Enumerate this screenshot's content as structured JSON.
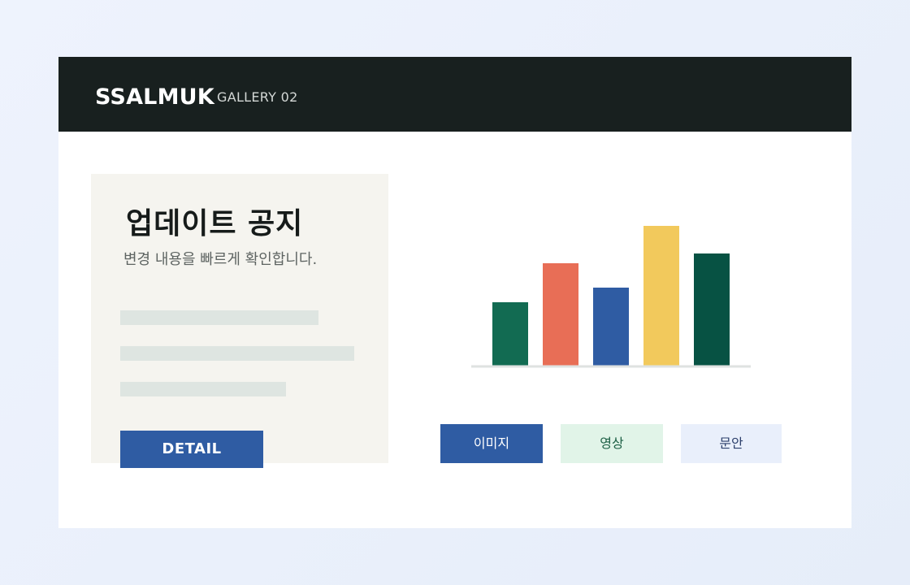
{
  "header": {
    "brand": "SSALMUK",
    "subtitle": "GALLERY 02"
  },
  "card": {
    "title": "업데이트 공지",
    "subtitle": "변경 내용을 빠르게 확인합니다.",
    "button_label": "DETAIL"
  },
  "colors": {
    "header_bg": "#18201f",
    "card_bg": "#f5f4ef",
    "primary_blue": "#2f5ca3",
    "chip_video_bg": "#e1f4e8",
    "chip_copy_bg": "#e9effb"
  },
  "chart_data": {
    "type": "bar",
    "categories": [
      "",
      "",
      "",
      "",
      ""
    ],
    "values": [
      78,
      126,
      96,
      172,
      138
    ],
    "colors": [
      "#126b52",
      "#e86e56",
      "#2f5ca3",
      "#f2c95c",
      "#075243"
    ],
    "ylim": [
      0,
      180
    ],
    "grid": false,
    "title": "",
    "xlabel": "",
    "ylabel": ""
  },
  "chips": [
    {
      "label": "이미지",
      "selected": true
    },
    {
      "label": "영상",
      "selected": false
    },
    {
      "label": "문안",
      "selected": false
    }
  ]
}
